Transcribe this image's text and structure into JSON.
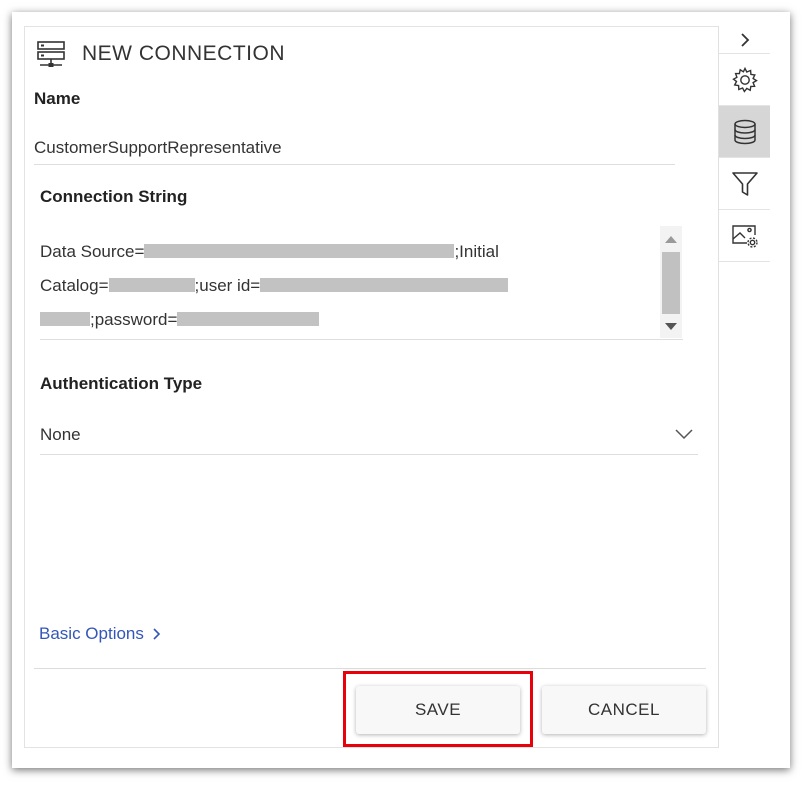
{
  "dialog": {
    "title": "NEW CONNECTION",
    "name_label": "Name",
    "name_value": "CustomerSupportRepresentative",
    "connection_string_label": "Connection String",
    "connection_string_lines": [
      "Data Source=",
      ";Initial",
      "Catalog=",
      ";user id=",
      ";password="
    ],
    "auth_label": "Authentication Type",
    "auth_value": "None",
    "basic_options_label": "Basic Options",
    "save_label": "SAVE",
    "cancel_label": "CANCEL"
  },
  "toolbar": {
    "items": [
      "collapse-chevron-icon",
      "gear-icon",
      "database-icon",
      "filter-icon",
      "image-settings-icon"
    ],
    "active": "database-icon"
  },
  "colors": {
    "link": "#3356b8",
    "highlight": "#e8000a",
    "active_rail": "#d6d6d6"
  }
}
